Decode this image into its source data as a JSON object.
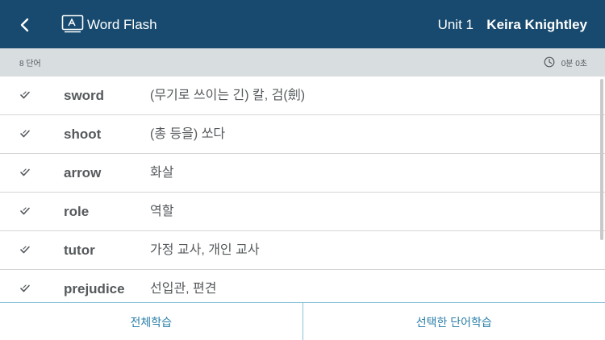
{
  "header": {
    "title": "Word Flash",
    "unit": "Unit 1",
    "user": "Keira Knightley",
    "bg_color": "#174a6e"
  },
  "info": {
    "word_count": "8 단어",
    "timer": "0분 0초"
  },
  "words": [
    {
      "en": "sword",
      "ko": "(무기로 쓰이는 긴) 칼, 검(劍)"
    },
    {
      "en": "shoot",
      "ko": "(총 등을) 쏘다"
    },
    {
      "en": "arrow",
      "ko": "화살"
    },
    {
      "en": "role",
      "ko": "역할"
    },
    {
      "en": "tutor",
      "ko": "가정 교사, 개인 교사"
    },
    {
      "en": "prejudice",
      "ko": "선입관, 편견"
    }
  ],
  "actions": {
    "study_all": "전체학습",
    "study_selected": "선택한 단어학습"
  },
  "colors": {
    "accent": "#2a7fa8",
    "text": "#55595c"
  }
}
